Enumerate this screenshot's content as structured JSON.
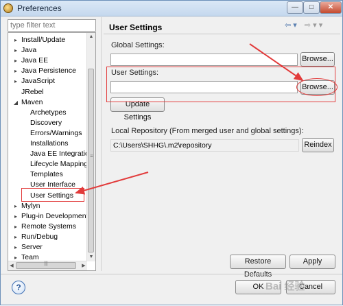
{
  "window": {
    "title": "Preferences",
    "minimize_glyph": "—",
    "maximize_glyph": "□",
    "close_glyph": "✕"
  },
  "filter": {
    "placeholder": "type filter text"
  },
  "tree": {
    "items": [
      {
        "label": "Install/Update",
        "expander": "▸"
      },
      {
        "label": "Java",
        "expander": "▸"
      },
      {
        "label": "Java EE",
        "expander": "▸"
      },
      {
        "label": "Java Persistence",
        "expander": "▸"
      },
      {
        "label": "JavaScript",
        "expander": "▸"
      },
      {
        "label": "JRebel",
        "expander": ""
      },
      {
        "label": "Maven",
        "expander": "◢"
      },
      {
        "label": "Archetypes",
        "expander": ""
      },
      {
        "label": "Discovery",
        "expander": ""
      },
      {
        "label": "Errors/Warnings",
        "expander": ""
      },
      {
        "label": "Installations",
        "expander": ""
      },
      {
        "label": "Java EE Integration",
        "expander": ""
      },
      {
        "label": "Lifecycle Mappings",
        "expander": ""
      },
      {
        "label": "Templates",
        "expander": ""
      },
      {
        "label": "User Interface",
        "expander": ""
      },
      {
        "label": "User Settings",
        "expander": ""
      },
      {
        "label": "Mylyn",
        "expander": "▸"
      },
      {
        "label": "Plug-in Development",
        "expander": "▸"
      },
      {
        "label": "Remote Systems",
        "expander": "▸"
      },
      {
        "label": "Run/Debug",
        "expander": "▸"
      },
      {
        "label": "Server",
        "expander": "▸"
      },
      {
        "label": "Team",
        "expander": "▸"
      }
    ],
    "scroll_up": "▲",
    "scroll_down": "▼",
    "scroll_left": "◀",
    "scroll_right": "▶",
    "grip": "≡",
    "hgrip": "|||"
  },
  "page": {
    "title": "User Settings",
    "nav_back": "⇦ ▾",
    "nav_forward": "⇨ ▾ ▾",
    "global_settings_label": "Global Settings:",
    "global_settings_value": "",
    "global_browse": "Browse...",
    "user_settings_label": "User Settings:",
    "user_settings_value": "",
    "user_browse": "Browse...",
    "update_settings": "Update Settings",
    "local_repo_label": "Local Repository (From merged user and global settings):",
    "local_repo_value": "C:\\Users\\SHHG\\.m2\\repository",
    "reindex": "Reindex",
    "restore_defaults": "Restore Defaults",
    "apply": "Apply"
  },
  "footer": {
    "help_glyph": "?",
    "ok": "OK",
    "cancel": "Cancel",
    "watermark": "Bai 经验"
  },
  "colors": {
    "annotation_red": "#e23b3b",
    "title_bar": "#c4d8ee",
    "close_button": "#c44a2f"
  }
}
